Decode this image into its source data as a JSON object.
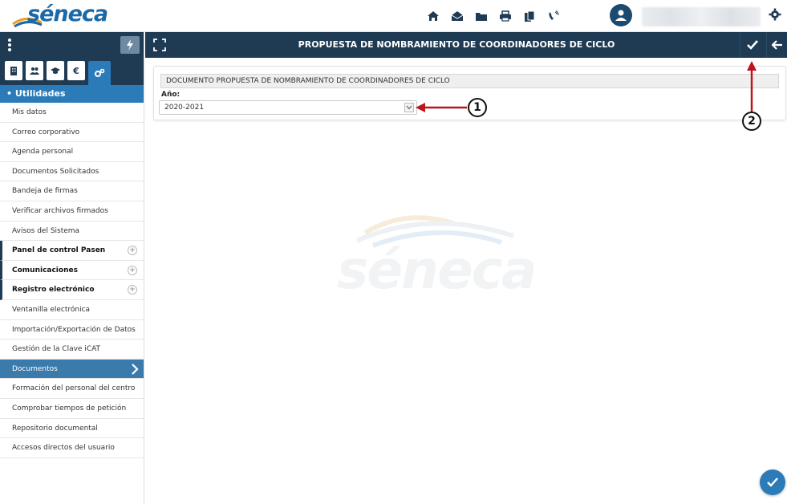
{
  "app": {
    "logo_text": "séneca"
  },
  "topbar": {
    "icons": [
      "home-icon",
      "mail-icon",
      "folder-icon",
      "print-icon",
      "copy-icon",
      "phone-icon"
    ]
  },
  "sidebar": {
    "tabs": [
      "building-icon",
      "people-icon",
      "graduation-icon",
      "euro-icon",
      "gears-icon"
    ],
    "section_title": "• Utilidades",
    "items": [
      {
        "label": "Mis datos"
      },
      {
        "label": "Correo corporativo"
      },
      {
        "label": "Agenda personal"
      },
      {
        "label": "Documentos Solicitados"
      },
      {
        "label": "Bandeja de firmas"
      },
      {
        "label": "Verificar archivos firmados"
      },
      {
        "label": "Avisos del Sistema"
      },
      {
        "label": "Panel de control Pasen",
        "expandable": true
      },
      {
        "label": "Comunicaciones",
        "expandable": true
      },
      {
        "label": "Registro electrónico",
        "expandable": true
      },
      {
        "label": "Ventanilla electrónica"
      },
      {
        "label": "Importación/Exportación de Datos"
      },
      {
        "label": "Gestión de la Clave iCAT"
      },
      {
        "label": "Documentos",
        "active": true
      },
      {
        "label": "Formación del personal del centro"
      },
      {
        "label": "Comprobar tiempos de petición"
      },
      {
        "label": "Repositorio documental"
      },
      {
        "label": "Accesos directos del usuario"
      }
    ]
  },
  "main": {
    "title": "PROPUESTA DE NOMBRAMIENTO DE COORDINADORES DE CICLO",
    "document_label": "DOCUMENTO PROPUESTA DE NOMBRAMIENTO DE COORDINADORES DE CICLO",
    "year_label": "Año:",
    "year_value": "2020-2021"
  },
  "annotations": {
    "one": "1",
    "two": "2"
  },
  "watermark": {
    "text": "séneca"
  },
  "colors": {
    "navy": "#1f3b53",
    "accent": "#2b7bb9",
    "annotation_red": "#c0141c"
  }
}
